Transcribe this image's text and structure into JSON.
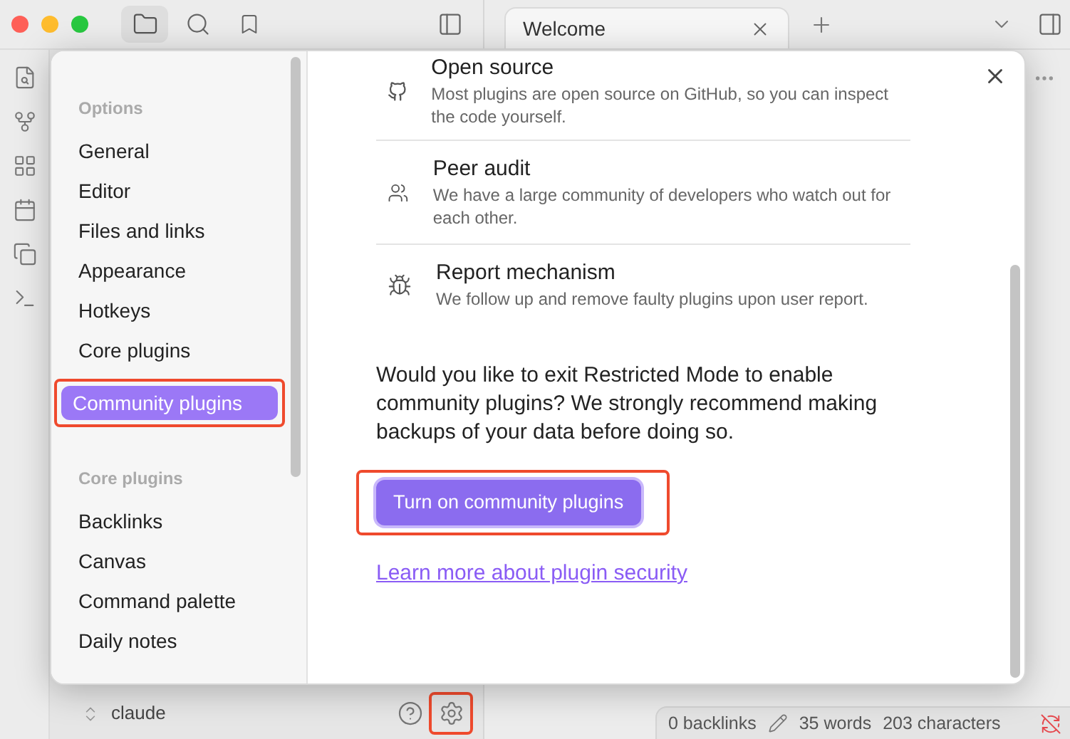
{
  "top_bar": {
    "tabs": [
      {
        "label": "Welcome",
        "selected": true
      }
    ]
  },
  "vault": {
    "name": "claude"
  },
  "settings_button": {
    "highlighted": true
  },
  "status_bar": {
    "items": [
      "0 backlinks",
      "35 words",
      "203 characters"
    ]
  },
  "settings": {
    "sections": [
      {
        "heading": "Options",
        "items": [
          {
            "label": "General",
            "selected": false,
            "highlighted": false
          },
          {
            "label": "Editor",
            "selected": false,
            "highlighted": false
          },
          {
            "label": "Files and links",
            "selected": false,
            "highlighted": false
          },
          {
            "label": "Appearance",
            "selected": false,
            "highlighted": false
          },
          {
            "label": "Hotkeys",
            "selected": false,
            "highlighted": false
          },
          {
            "label": "Core plugins",
            "selected": false,
            "highlighted": false
          },
          {
            "label": "Community plugins",
            "selected": true,
            "highlighted": true
          }
        ]
      },
      {
        "heading": "Core plugins",
        "items": [
          {
            "label": "Backlinks",
            "selected": false,
            "highlighted": false
          },
          {
            "label": "Canvas",
            "selected": false,
            "highlighted": false
          },
          {
            "label": "Command palette",
            "selected": false,
            "highlighted": false
          },
          {
            "label": "Daily notes",
            "selected": false,
            "highlighted": false
          }
        ]
      }
    ],
    "features": [
      {
        "kind": "github",
        "title": "Open source",
        "description": "Most plugins are open source on GitHub, so you can inspect the code yourself."
      },
      {
        "kind": "users",
        "title": "Peer audit",
        "description": "We have a large community of developers who watch out for each other."
      },
      {
        "kind": "bug",
        "title": "Report mechanism",
        "description": "We follow up and remove faulty plugins upon user report."
      }
    ],
    "warning": "Would you like to exit Restricted Mode to enable community plugins? We strongly recommend making backups of your data before doing so.",
    "primary_button": {
      "label": "Turn on community plugins",
      "highlighted": true
    },
    "link": "Learn more about plugin security"
  }
}
